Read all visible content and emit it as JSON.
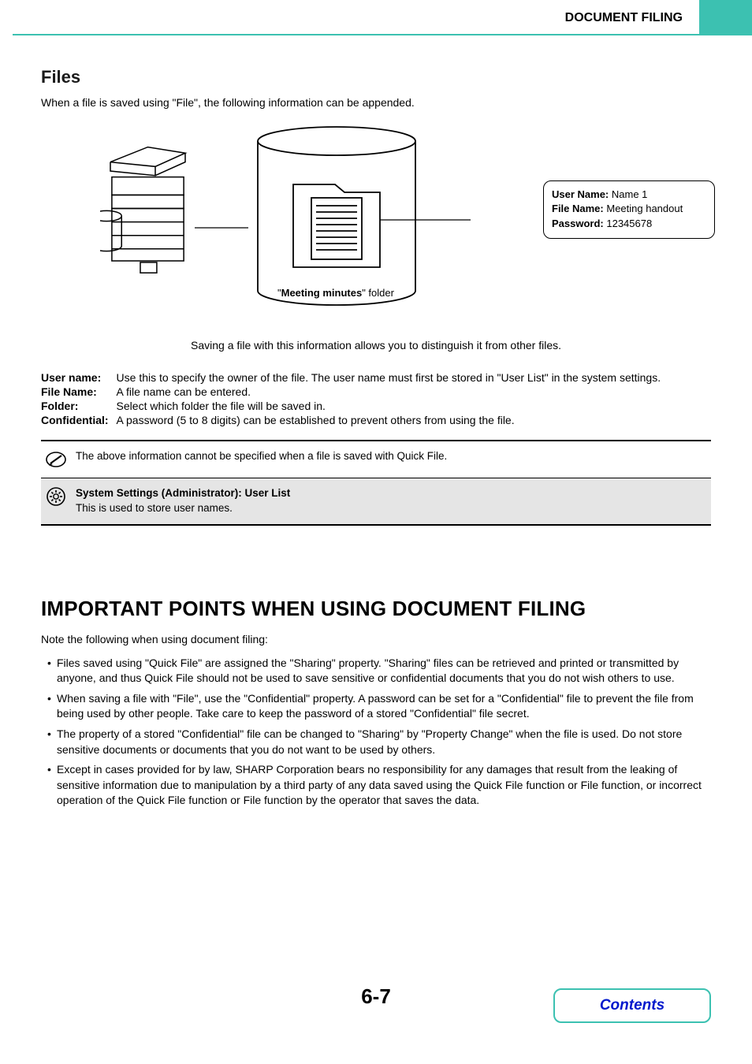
{
  "header": {
    "title": "DOCUMENT FILING"
  },
  "section1": {
    "heading": "Files",
    "intro": "When a file is saved using \"File\", the following information can be appended."
  },
  "callout": {
    "user_name_label": "User Name:",
    "user_name_value": " Name 1",
    "file_name_label": "File Name:",
    "file_name_value": " Meeting handout",
    "password_label": "Password:",
    "password_value": " 12345678"
  },
  "folder_label_prefix": "\"",
  "folder_label_bold": "Meeting minutes",
  "folder_label_suffix": "\" folder",
  "caption": "Saving a file with this information allows you to distinguish it from other files.",
  "definitions": [
    {
      "term": "User name:",
      "desc": "Use this to specify the owner of the file. The user name must first be stored in \"User List\" in the system settings."
    },
    {
      "term": "File Name:",
      "desc": "A file name can be entered."
    },
    {
      "term": "Folder:",
      "desc": "Select which folder the file will be saved in."
    },
    {
      "term": "Confidential:",
      "desc": "A password (5 to 8 digits) can be established to prevent others from using the file."
    }
  ],
  "note1": "The above information cannot be specified when a file is saved with Quick File.",
  "note2_title": "System Settings (Administrator): User List",
  "note2_body": "This is used to store user names.",
  "section2": {
    "heading": "IMPORTANT POINTS WHEN USING DOCUMENT FILING",
    "intro": "Note the following when using document filing:",
    "bullets": [
      "Files saved using \"Quick File\" are assigned the \"Sharing\" property. \"Sharing\" files can be retrieved and printed or transmitted by anyone, and thus Quick File should not be used to save sensitive or confidential documents that you do not wish others to use.",
      "When saving a file with \"File\", use the \"Confidential\" property. A password can be set for a \"Confidential\" file to prevent the file from being used by other people. Take care to keep the password of a stored \"Confidential\" file secret.",
      "The property of a stored \"Confidential\" file can be changed to \"Sharing\" by \"Property Change\" when the file is used. Do not store sensitive documents or documents that you do not want to be used by others.",
      "Except in cases provided for by law, SHARP Corporation bears no responsibility for any damages that result from the leaking of sensitive information due to manipulation by a third party of any data saved using the Quick File function or File function, or incorrect operation of the Quick File function or File function by the operator that saves the data."
    ]
  },
  "page_number": "6-7",
  "contents_label": "Contents"
}
